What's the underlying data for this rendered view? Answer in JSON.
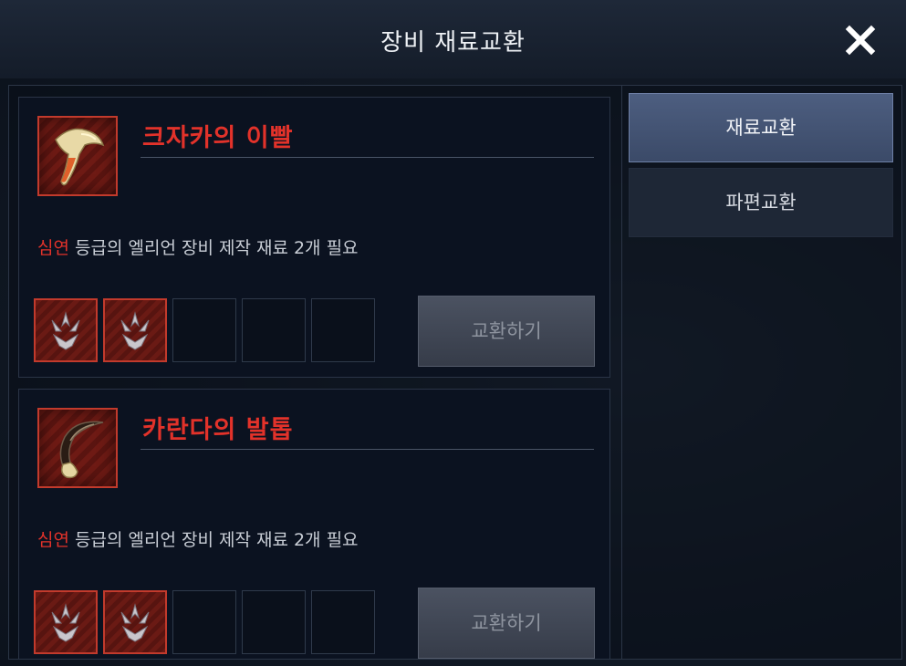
{
  "header": {
    "title": "장비 재료교환",
    "close_icon": "close-icon"
  },
  "tabs": [
    {
      "label": "재료교환",
      "active": true
    },
    {
      "label": "파편교환",
      "active": false
    }
  ],
  "items": [
    {
      "name": "크자카의 이빨",
      "icon": "fang-icon",
      "requirement": {
        "grade": "심연",
        "text": " 등급의 엘리언 장비 제작 재료 2개 필요"
      },
      "slots_filled": 2,
      "slots_total": 5,
      "button_label": "교환하기"
    },
    {
      "name": "카란다의 발톱",
      "icon": "claw-icon",
      "requirement": {
        "grade": "심연",
        "text": " 등급의 엘리언 장비 제작 재료 2개 필요"
      },
      "slots_filled": 2,
      "slots_total": 5,
      "button_label": "교환하기"
    }
  ],
  "colors": {
    "grade_red": "#e2322a",
    "active_tab": "#4d5e80",
    "panel_bg": "#0b1220"
  }
}
